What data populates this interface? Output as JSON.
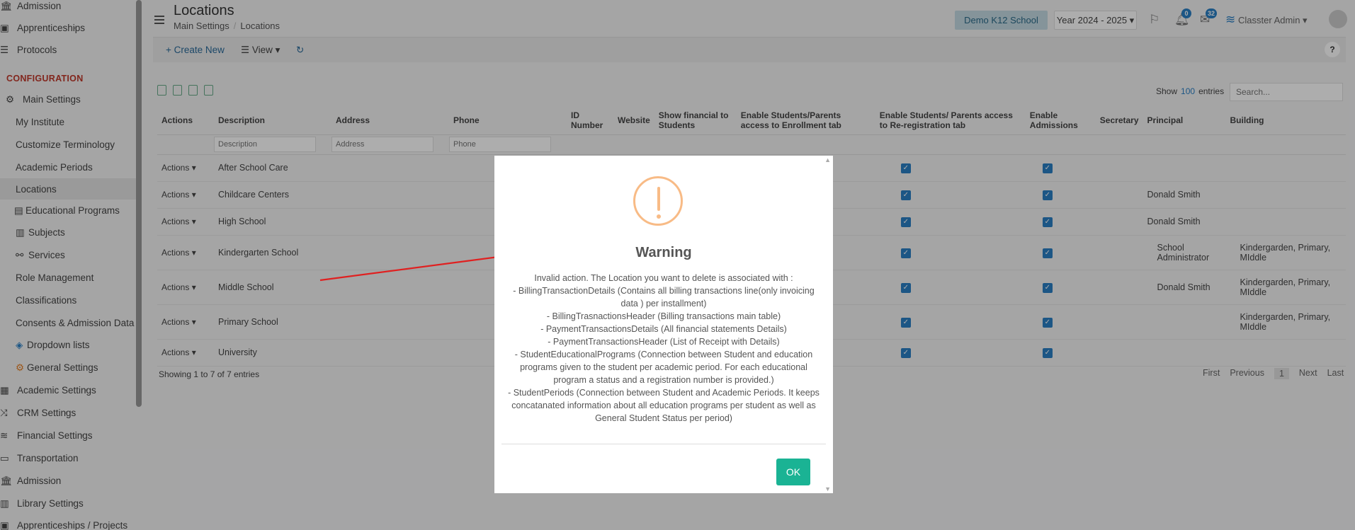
{
  "sidebar": {
    "items": [
      {
        "label": "Admission",
        "type": "top"
      },
      {
        "label": "Apprenticeships",
        "type": "top"
      },
      {
        "label": "Protocols",
        "type": "top"
      },
      {
        "label": "CONFIGURATION",
        "type": "section"
      },
      {
        "label": "Main Settings",
        "type": "top"
      },
      {
        "label": "My Institute",
        "type": "sub"
      },
      {
        "label": "Customize Terminology",
        "type": "sub"
      },
      {
        "label": "Academic Periods",
        "type": "sub"
      },
      {
        "label": "Locations",
        "type": "sub"
      },
      {
        "label": "Educational Programs",
        "type": "sub"
      },
      {
        "label": "Subjects",
        "type": "sub"
      },
      {
        "label": "Services",
        "type": "sub"
      },
      {
        "label": "Role Management",
        "type": "sub"
      },
      {
        "label": "Classifications",
        "type": "sub"
      },
      {
        "label": "Consents & Admission Data",
        "type": "sub"
      },
      {
        "label": "Dropdown lists",
        "type": "sub"
      },
      {
        "label": "General Settings",
        "type": "sub"
      },
      {
        "label": "Academic Settings",
        "type": "top"
      },
      {
        "label": "CRM Settings",
        "type": "top"
      },
      {
        "label": "Financial Settings",
        "type": "top"
      },
      {
        "label": "Transportation",
        "type": "top"
      },
      {
        "label": "Admission",
        "type": "top"
      },
      {
        "label": "Library Settings",
        "type": "top"
      },
      {
        "label": "Apprenticeships / Projects",
        "type": "top"
      }
    ]
  },
  "header": {
    "title": "Locations",
    "breadcrumb": [
      "Main Settings",
      "Locations"
    ],
    "school": "Demo K12 School",
    "year": "Year 2024 - 2025",
    "notifications_count": "0",
    "messages_count": "32",
    "user": "Classter Admin"
  },
  "toolbar": {
    "create_new": "Create New",
    "view": "View",
    "help": "?"
  },
  "table": {
    "show_label": "Show",
    "show_value": "100",
    "entries_label": "entries",
    "search_placeholder": "Search...",
    "columns": [
      "Actions",
      "Description",
      "Address",
      "Phone",
      "ID Number",
      "Website",
      "Show financial to Students",
      "Enable Students/Parents access to Enrollment tab",
      "Enable Students/ Parents access to Re-registration tab",
      "Enable Admissions",
      "Secretary",
      "Principal",
      "Building"
    ],
    "filter_placeholders": {
      "description": "Description",
      "address": "Address",
      "phone": "Phone"
    },
    "rows": [
      {
        "actions": "Actions",
        "description": "After School Care",
        "principal": "",
        "building": ""
      },
      {
        "actions": "Actions",
        "description": "Childcare Centers",
        "principal": "Donald Smith",
        "building": ""
      },
      {
        "actions": "Actions",
        "description": "High School",
        "principal": "Donald Smith",
        "building": ""
      },
      {
        "actions": "Actions",
        "description": "Kindergarten School",
        "principal": "School Administrator",
        "building": "Kindergarden, Primary, MIddle"
      },
      {
        "actions": "Actions",
        "description": "Middle School",
        "principal": "Donald Smith",
        "building": "Kindergarden, Primary, MIddle"
      },
      {
        "actions": "Actions",
        "description": "Primary School",
        "principal": "",
        "building": "Kindergarden, Primary, MIddle"
      },
      {
        "actions": "Actions",
        "description": "University",
        "principal": "",
        "building": ""
      }
    ],
    "info": "Showing 1 to 7 of 7 entries",
    "pagination": {
      "first": "First",
      "previous": "Previous",
      "current": "1",
      "next": "Next",
      "last": "Last"
    }
  },
  "modal": {
    "title": "Warning",
    "body_lines": [
      "Invalid action. The Location you want to delete is associated with :",
      "- BillingTransactionDetails (Contains all billing transactions line(only invoicing data ) per installment)",
      "- BillingTrasnactionsHeader (Billing transactions main table)",
      "- PaymentTransactionsDetails (All financial statements Details)",
      "- PaymentTransactionsHeader (List of Receipt with Details)",
      "- StudentEducationalPrograms (Connection between Student and education programs given to the student per academic period. For each educational program a status and a registration number is provided.)",
      "- StudentPeriods (Connection between Student and Academic Periods. It keeps concatanated information about all education programs per student as well as General Student Status per period)"
    ],
    "ok": "OK"
  },
  "colors": {
    "accent": "#2a7fc4",
    "ok_button": "#1ab394",
    "warning": "#f8bb86",
    "arrow": "#e02020",
    "config": "#c0392b"
  }
}
